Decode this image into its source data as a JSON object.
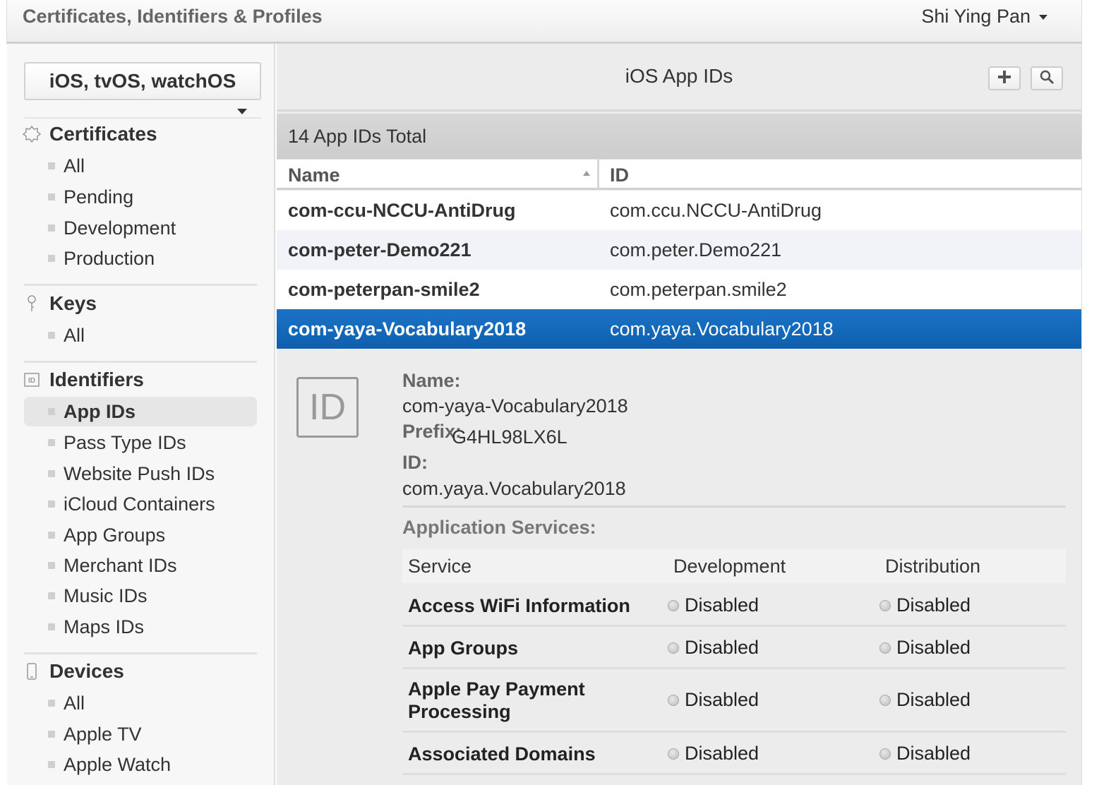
{
  "header": {
    "app_title": "Certificates, Identifiers & Profiles",
    "user_name": "Shi Ying Pan"
  },
  "sidebar": {
    "platform": "iOS, tvOS, watchOS",
    "sections": [
      {
        "title": "Certificates",
        "icon": "certificate-icon",
        "items": [
          "All",
          "Pending",
          "Development",
          "Production"
        ]
      },
      {
        "title": "Keys",
        "icon": "key-icon",
        "items": [
          "All"
        ]
      },
      {
        "title": "Identifiers",
        "icon": "id-icon",
        "items": [
          "App IDs",
          "Pass Type IDs",
          "Website Push IDs",
          "iCloud Containers",
          "App Groups",
          "Merchant IDs",
          "Music IDs",
          "Maps IDs"
        ]
      },
      {
        "title": "Devices",
        "icon": "device-icon",
        "items": [
          "All",
          "Apple TV",
          "Apple Watch"
        ]
      }
    ],
    "active_item": "App IDs"
  },
  "main": {
    "title": "iOS App IDs",
    "total": "14 App IDs Total",
    "columns": {
      "name": "Name",
      "id": "ID"
    },
    "rows": [
      {
        "name": "com-ccu-NCCU-AntiDrug",
        "id": "com.ccu.NCCU-AntiDrug"
      },
      {
        "name": "com-peter-Demo221",
        "id": "com.peter.Demo221"
      },
      {
        "name": "com-peterpan-smile2",
        "id": "com.peterpan.smile2"
      },
      {
        "name": "com-yaya-Vocabulary2018",
        "id": "com.yaya.Vocabulary2018"
      }
    ],
    "selected_row": 3
  },
  "detail": {
    "badge": "ID",
    "name_label": "Name:",
    "name_value": "com-yaya-Vocabulary2018",
    "prefix_label": "Prefix:",
    "prefix_value": "G4HL98LX6L",
    "id_label": "ID:",
    "id_value": "com.yaya.Vocabulary2018",
    "services_title": "Application Services:",
    "services_header": {
      "service": "Service",
      "development": "Development",
      "distribution": "Distribution"
    },
    "services": [
      {
        "service": "Access WiFi Information",
        "development": "Disabled",
        "distribution": "Disabled"
      },
      {
        "service": "App Groups",
        "development": "Disabled",
        "distribution": "Disabled"
      },
      {
        "service": "Apple Pay Payment Processing",
        "development": "Disabled",
        "distribution": "Disabled"
      },
      {
        "service": "Associated Domains",
        "development": "Disabled",
        "distribution": "Disabled"
      }
    ]
  },
  "colors": {
    "selected_row": "#1667bb",
    "sidebar_bg": "#f7f7f7",
    "main_bg": "#ececec"
  }
}
